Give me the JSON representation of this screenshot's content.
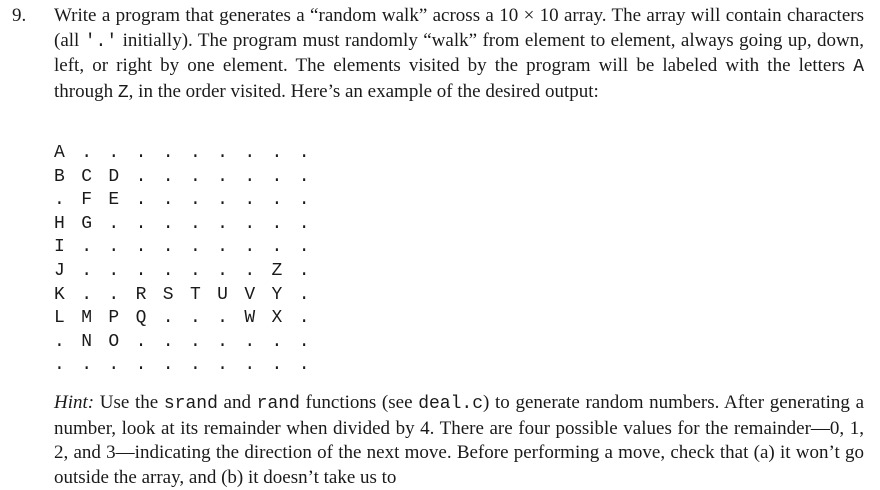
{
  "exercise": {
    "number": "9.",
    "intro": {
      "part1": "Write a program that generates a “random walk” across a 10 × 10 array. The array will contain characters (all ",
      "code1": "'.'",
      "part2": " initially). The program must randomly “walk” from element to element, always going up, down, left, or right by one element. The elements visited by the program will be labeled with the letters ",
      "code2": "A",
      "part3": " through ",
      "code3": "Z",
      "part4": ", in the order visited. Here’s an example of the desired output:"
    },
    "example_grid": [
      [
        "A",
        ".",
        ".",
        ".",
        ".",
        ".",
        ".",
        ".",
        ".",
        "."
      ],
      [
        "B",
        "C",
        "D",
        ".",
        ".",
        ".",
        ".",
        ".",
        ".",
        "."
      ],
      [
        ".",
        "F",
        "E",
        ".",
        ".",
        ".",
        ".",
        ".",
        ".",
        "."
      ],
      [
        "H",
        "G",
        ".",
        ".",
        ".",
        ".",
        ".",
        ".",
        ".",
        "."
      ],
      [
        "I",
        ".",
        ".",
        ".",
        ".",
        ".",
        ".",
        ".",
        ".",
        "."
      ],
      [
        "J",
        ".",
        ".",
        ".",
        ".",
        ".",
        ".",
        ".",
        "Z",
        "."
      ],
      [
        "K",
        ".",
        ".",
        "R",
        "S",
        "T",
        "U",
        "V",
        "Y",
        "."
      ],
      [
        "L",
        "M",
        "P",
        "Q",
        ".",
        ".",
        ".",
        "W",
        "X",
        "."
      ],
      [
        ".",
        "N",
        "O",
        ".",
        ".",
        ".",
        ".",
        ".",
        ".",
        "."
      ],
      [
        ".",
        ".",
        ".",
        ".",
        ".",
        ".",
        ".",
        ".",
        ".",
        "."
      ]
    ],
    "hint": {
      "label": "Hint:",
      "part1": " Use the ",
      "code1": "srand",
      "part2": " and ",
      "code2": "rand",
      "part3": " functions (see ",
      "code3": "deal.c",
      "part4": ") to generate random numbers. After generating a number, look at its remainder when divided by 4. There are four possible values for the remainder—0, 1, 2, and 3—indicating the direction of the next move. Before performing a move, check that (a) it won’t go outside the array, and (b) it doesn’t take us to"
    }
  }
}
